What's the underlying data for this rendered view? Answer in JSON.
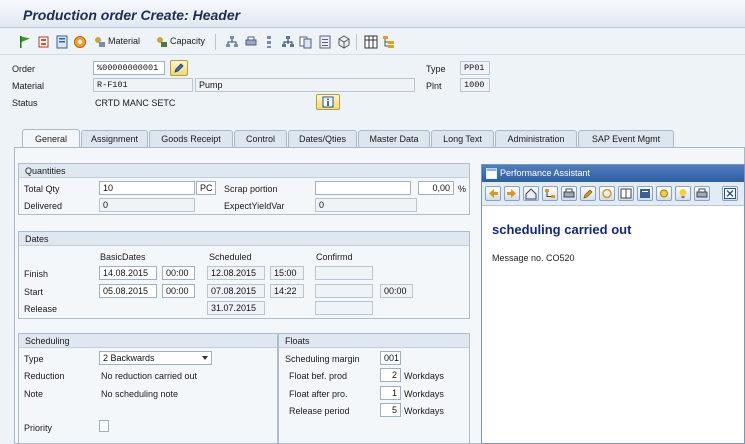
{
  "window": {
    "title": "Production order Create: Header"
  },
  "toolbar": {
    "material_label": "Material",
    "capacity_label": "Capacity",
    "icons": [
      "flag-icon",
      "release-icon",
      "save-icon",
      "status-icon",
      "material-icon",
      "capacity-icon",
      "hierarchy-icon",
      "print-icon",
      "list-icon",
      "network-icon",
      "copy-icon",
      "document-icon",
      "cube-icon",
      "grid-icon",
      "tree-icon"
    ]
  },
  "header": {
    "order_label": "Order",
    "order_value": "%00000000001",
    "material_label": "Material",
    "material_value": "R-F101",
    "material_desc": "Pump",
    "status_label": "Status",
    "status_value": "CRTD MANC SETC",
    "type_label": "Type",
    "type_value": "PP01",
    "plant_label": "Plnt",
    "plant_value": "1000"
  },
  "tabs": [
    {
      "label": "General",
      "active": true
    },
    {
      "label": "Assignment"
    },
    {
      "label": "Goods Receipt"
    },
    {
      "label": "Control"
    },
    {
      "label": "Dates/Qties"
    },
    {
      "label": "Master Data"
    },
    {
      "label": "Long Text"
    },
    {
      "label": "Administration"
    },
    {
      "label": "SAP Event Mgmt"
    }
  ],
  "quantities": {
    "title": "Quantities",
    "total_qty_label": "Total Qty",
    "total_qty_value": "10",
    "unit": "PC",
    "scrap_label": "Scrap portion",
    "scrap_value": "",
    "scrap_pct": "0,00",
    "pct_sign": "%",
    "delivered_label": "Delivered",
    "delivered_value": "0",
    "expect_label": "ExpectYieldVar",
    "expect_value": "0"
  },
  "dates": {
    "title": "Dates",
    "col_basic": "BasicDates",
    "col_scheduled": "Scheduled",
    "col_confirmed": "Confirmd",
    "finish_label": "Finish",
    "finish_basic_date": "14.08.2015",
    "finish_basic_time": "00:00",
    "finish_sched_date": "12.08.2015",
    "finish_sched_time": "15:00",
    "start_label": "Start",
    "start_basic_date": "05.08.2015",
    "start_basic_time": "00:00",
    "start_sched_date": "07.08.2015",
    "start_sched_time": "14:22",
    "start_conf_time": "00:00",
    "release_label": "Release",
    "release_sched_date": "31.07.2015"
  },
  "scheduling": {
    "title": "Scheduling",
    "type_label": "Type",
    "type_value": "2 Backwards",
    "reduction_label": "Reduction",
    "reduction_value": "No reduction carried out",
    "note_label": "Note",
    "note_value": "No scheduling note",
    "priority_label": "Priority"
  },
  "floats": {
    "title": "Floats",
    "margin_label": "Scheduling margin",
    "margin_value": "001",
    "bef_label": "Float bef. prod",
    "bef_value": "2",
    "after_label": "Float after pro.",
    "after_value": "1",
    "release_label": "Release period",
    "release_value": "5",
    "unit": "Workdays"
  },
  "assistant": {
    "title": "Performance Assistant",
    "message": "scheduling carried out",
    "message_no": "Message no. CO520"
  }
}
